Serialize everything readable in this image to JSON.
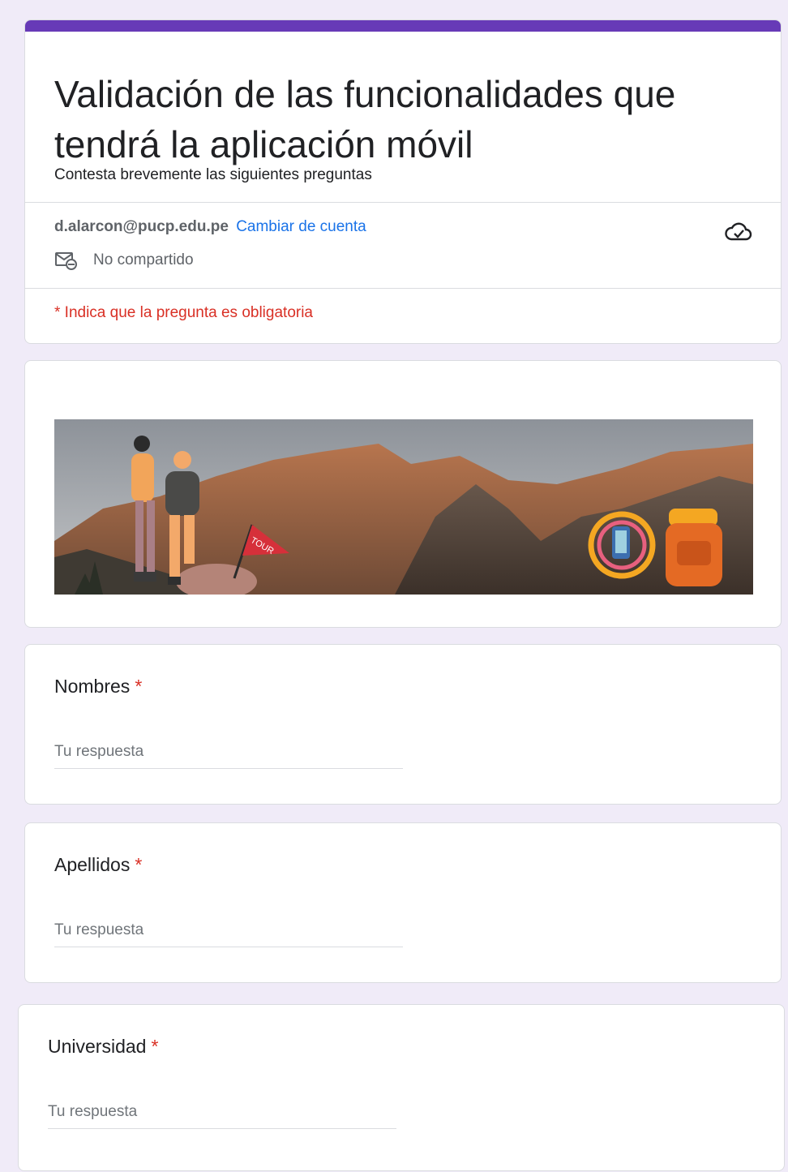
{
  "header": {
    "title": "Validación de las funcionalidades que tendrá la aplicación móvil",
    "description": "Contesta brevemente las siguientes preguntas",
    "account_email": "d.alarcon@pucp.edu.pe",
    "switch_account": "Cambiar de cuenta",
    "not_shared": "No compartido",
    "required_note": "* Indica que la pregunta es obligatoria",
    "accent_color": "#673ab7"
  },
  "banner": {
    "flag_text": "TOUR"
  },
  "questions": [
    {
      "label": "Nombres",
      "required_mark": "*",
      "placeholder": "Tu respuesta"
    },
    {
      "label": "Apellidos",
      "required_mark": "*",
      "placeholder": "Tu respuesta"
    },
    {
      "label": "Universidad",
      "required_mark": "*",
      "placeholder": "Tu respuesta"
    }
  ],
  "icons": {
    "not_shared": "mail-blocked-icon",
    "saved": "cloud-check-icon"
  }
}
